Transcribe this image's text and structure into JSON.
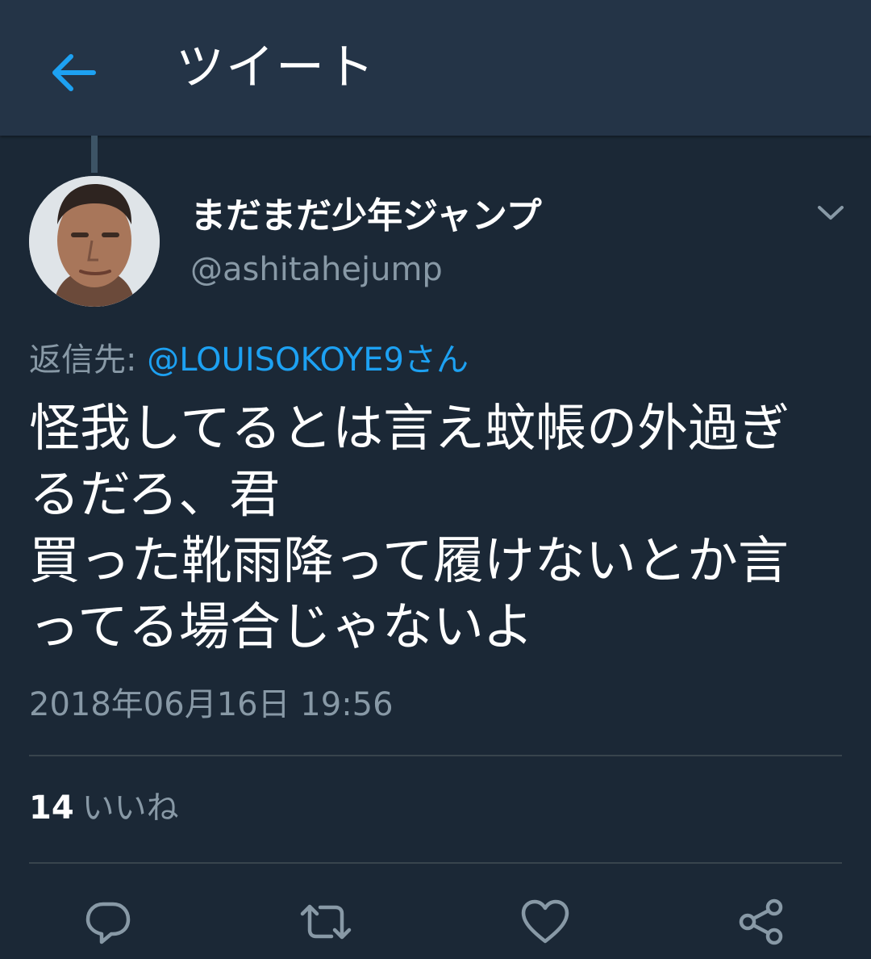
{
  "header": {
    "title": "ツイート",
    "back_icon": "arrow-left-icon",
    "accent_color": "#1da1f2"
  },
  "tweet": {
    "display_name": "まだまだ少年ジャンプ",
    "handle": "@ashitahejump",
    "reply_label": "返信先: ",
    "reply_to": "@LOUISOKOYE9さん",
    "text_lines": [
      "怪我してるとは言え蚊帳の外過ぎ",
      "るだろ、君",
      "買った靴雨降って履けないとか言",
      "ってる場合じゃないよ"
    ],
    "timestamp": "2018年06月16日 19:56",
    "likes_count": "14",
    "likes_label": "いいね"
  },
  "actions": [
    {
      "icon": "reply-icon"
    },
    {
      "icon": "retweet-icon"
    },
    {
      "icon": "heart-icon"
    },
    {
      "icon": "share-icon"
    }
  ],
  "colors": {
    "background": "#1b2836",
    "header": "#243447",
    "secondary_text": "#8899a6",
    "link": "#1da1f2"
  }
}
